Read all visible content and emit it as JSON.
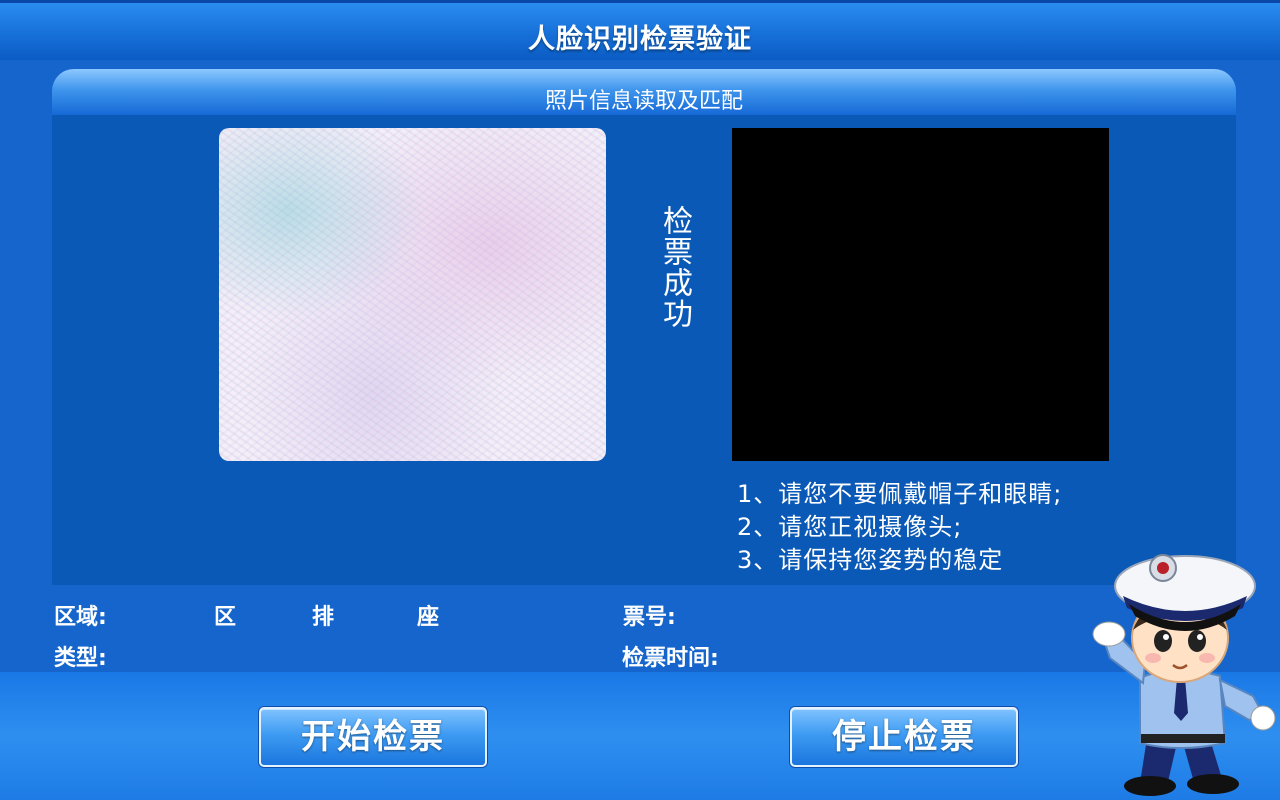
{
  "app": {
    "title": "人脸识别检票验证"
  },
  "panel": {
    "header": "照片信息读取及匹配",
    "status": "检票成功"
  },
  "instructions": [
    "1、请您不要佩戴帽子和眼睛;",
    "2、请您正视摄像头;",
    "3、请保持您姿势的稳定"
  ],
  "info": {
    "area_label": "区域:",
    "zone_label": "区",
    "row_label": "排",
    "seat_label": "座",
    "ticket_no_label": "票号:",
    "type_label": "类型:",
    "check_time_label": "检票时间:"
  },
  "buttons": {
    "start": "开始检票",
    "stop": "停止检票"
  },
  "colors": {
    "background": "#1565cc",
    "panel_body": "#0a59b6",
    "button_gradient_top": "#7fc2ff",
    "button_gradient_bottom": "#1a76de"
  },
  "icons": {
    "mascot": "police-officer-saluting-mascot"
  }
}
